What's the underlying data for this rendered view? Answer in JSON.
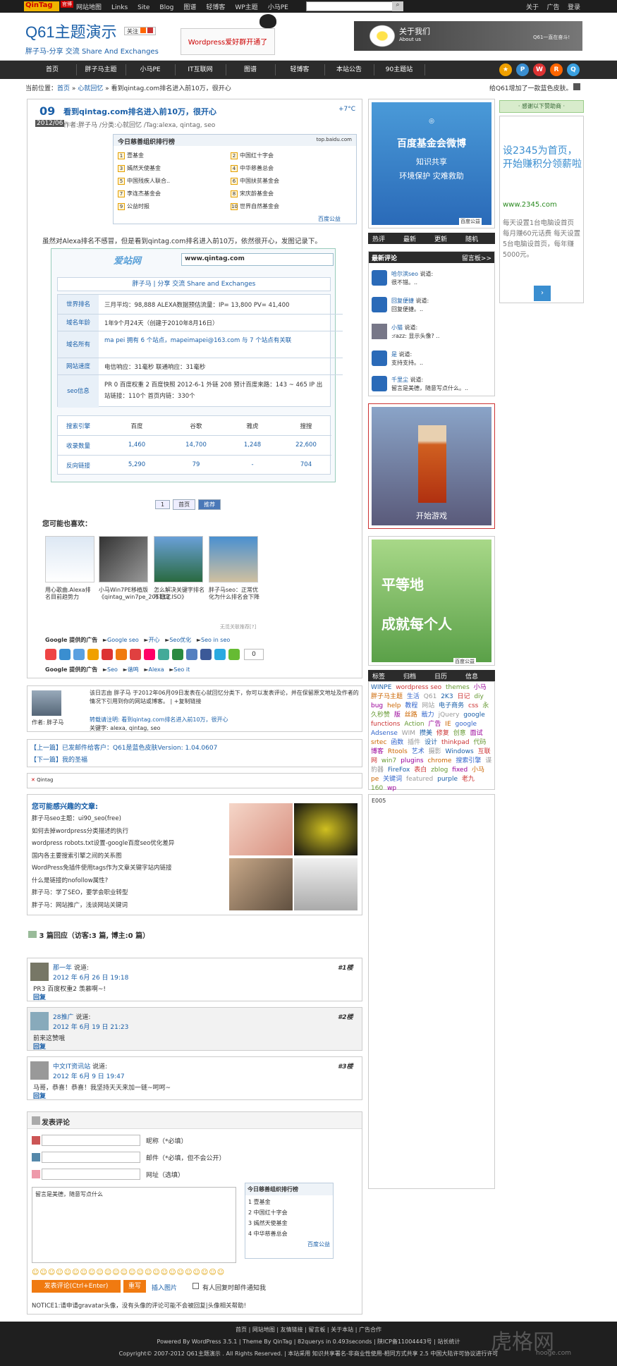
{
  "topbar": {
    "logo": "QinTag",
    "badge": "官博",
    "nav": [
      "网站地图",
      "Links",
      "Site",
      "Blog",
      "图谱",
      "轻博客",
      "WP主题",
      "小马PE"
    ],
    "right": [
      "关于",
      "广告",
      "登录"
    ]
  },
  "header": {
    "title": "Q61主题演示",
    "follow": "关注",
    "subtitle": "胖子马-分享 交流 Share And Exchanges",
    "bubble": "Wordpress爱好群开通了",
    "about": "关于我们",
    "about_en": "About us",
    "slogan": "Q61一直在奋斗!"
  },
  "nav": [
    "首页",
    "胖子马主题",
    "小马PE",
    "IT互联网",
    "图谱",
    "轻博客",
    "本站公告",
    "90主题站"
  ],
  "breadcrumb": {
    "prefix": "当前位置：",
    "home": "首页",
    "cat": "心就回忆",
    "current": "看到qintag.com排名进入前10万，很开心",
    "right": "给Q61增加了一款蓝色皮肤。"
  },
  "post": {
    "day": "09",
    "ym": "2012/06",
    "title": "看到qintag.com排名进入前10万，很开心",
    "author": "作者:胖子马",
    "cat": "/分类:心就回忆",
    "tags": "/Tag:alexa, qintag, seo",
    "temp": "+7°C",
    "body": "虽然对Alexa排名不感冒，但是看到qintag.com排名进入前10万，依然很开心，发图记录下。"
  },
  "rank": {
    "title": "今日慈善组织排行榜",
    "src": "top.baidu.com",
    "items": [
      "壹基金",
      "中国红十字会",
      "嫣然天使基金",
      "中华慈善总会",
      "中国残疾人联合..",
      "中国扶贫基金会",
      "李连杰基金会",
      "宋庆龄基金会",
      "公益时报",
      "世界自然基金会"
    ],
    "foot": "百度公益"
  },
  "alexa": {
    "logo": "爱站网",
    "url": "www.qintag.com",
    "site": "胖子马 | 分享 交流 Share and Exchanges",
    "rows": [
      {
        "label": "世界排名",
        "value": "三月平均：98,888  ALEXA数据预估流量：IP= 13,800 PV= 41,400"
      },
      {
        "label": "域名年龄",
        "value": "1年9个月24天（创建于2010年8月16日）"
      },
      {
        "label": "域名所有",
        "value": "ma pei 拥有 6 个站点，mapeimapei@163.com 与 7 个站点有关联"
      },
      {
        "label": "网站速度",
        "value": "电信响应：31毫秒    联通响应：31毫秒"
      },
      {
        "label": "seo信息",
        "value": "PR 0  百度权重 2   百度快照 2012-6-1   外链 208   预计百度来路：143 ~ 465 IP   出站链接：110个 首页内链：330个"
      }
    ],
    "engines": [
      "搜索引擎",
      "百度",
      "谷歌",
      "雅虎",
      "搜搜"
    ],
    "indexed": [
      "收录数量",
      "1,460",
      "14,700",
      "1,248",
      "22,600"
    ],
    "backlinks": [
      "反向链接",
      "5,290",
      "79",
      "-",
      "704"
    ]
  },
  "pager": [
    "1",
    "首页",
    "推荐"
  ],
  "maylike": {
    "title": "您可能也喜欢：",
    "items": [
      "用心歌曲.Alexa排名目前趋势力",
      "小马Win7PE移植版《qintag_win7pe_201112.ISO》",
      "怎么解决关键字排名不稳定",
      "胖子马seo：正常优化为什么排名会下降"
    ],
    "powered": "无觅关联推荐[?]"
  },
  "ads1": {
    "label": "Google 提供的广告",
    "links": [
      "Google seo",
      "开心",
      "Seo优化",
      "Seo in seo"
    ]
  },
  "ads2": {
    "label": "Google 提供的广告",
    "links": [
      "Seo",
      "谐鸣",
      "Alexa",
      "Seo it"
    ]
  },
  "share_count": "0",
  "author_box": {
    "name": "作者: 胖子马",
    "text": "该日志由 胖子马 于2012年06月09日发表在心就回忆分类下，你可以发表评论，并在保留原文地址及作者的情况下引用到你的网站或博客。 | +复制链接",
    "link": "转载请注明: 看到qintag.com排名进入前10万，很开心",
    "tags": "关键字: alexa, qintag, seo"
  },
  "prevnext": {
    "prev": "【上一篇】已发邮件给客户：Q61是蓝色皮肤Version: 1.04.0607",
    "next": "【下一篇】我的圣福"
  },
  "qintag_small": "Qintag",
  "related": {
    "title": "您可能感兴趣的文章:",
    "items": [
      "胖子马seo主题：ui90_seo(free)",
      "如何去掉wordpress分类描述的执行",
      "wordpress robots.txt设置-google百度seo优化差异",
      "国内各主要搜索引擎之间的关系图",
      "WordPress免插件使用tags作为文章关键字站内链接",
      "什么是链接的nofollow属性?",
      "胖子马：学了SEO，要学会职业转型",
      "胖子马：网站推广，浅谈网站关键词"
    ]
  },
  "comments": {
    "title": "3 篇回应（访客:3 篇, 博主:0 篇）",
    "list": [
      {
        "name": "那一年",
        "said": "说道:",
        "time": "2012 年 6月 26 日 19:18",
        "text": "PR3 百度权重2 羡慕啊~!",
        "reply": "回复",
        "floor": "#1楼"
      },
      {
        "name": "28推广",
        "said": "说道:",
        "time": "2012 年 6月 19 日 21:23",
        "text": "前来这赞哦",
        "reply": "回复",
        "floor": "#2楼"
      },
      {
        "name": "中文IT资讯站",
        "said": "说道:",
        "time": "2012 年 6月 9 日 19:47",
        "text": "马哥，恭喜！恭喜！我坚持天天来加一链~呵呵~",
        "reply": "回复",
        "floor": "#3楼"
      }
    ]
  },
  "form": {
    "title": "发表评论",
    "name_label": "昵称（*必填）",
    "email_label": "邮件（*必填，但不会公开）",
    "url_label": "网址（选填）",
    "placeholder": "留言是美德，随意写点什么",
    "submit": "发表评论(Ctrl+Enter)",
    "reset": "重写",
    "insert": "插入图片",
    "notify": "有人回复时邮件通知我",
    "notice": "NOTICE1:请申请gravatar头像，没有头像的评论可能不会被回复|头像相关帮助!"
  },
  "sidebar": {
    "fund": {
      "title": "百度基金会微博",
      "line1": "知识共享",
      "line2": "环境保护 灾难救助",
      "foot": "百度公益"
    },
    "tabs": [
      "热评",
      "最新",
      "更新",
      "随机"
    ],
    "recent": {
      "title": "最新评论",
      "more": "留言板>>",
      "items": [
        {
          "name": "哈尔滨seo",
          "said": "说道:",
          "text": "很不错。.."
        },
        {
          "name": "回复便捷",
          "said": "说道:",
          "text": "回复便捷。.."
        },
        {
          "name": "小猫",
          "said": "说道:",
          "text": ":razz: 显示头像? .."
        },
        {
          "name": "是",
          "said": "说道:",
          "text": "支持支持。.."
        },
        {
          "name": "千里尘",
          "said": "说道:",
          "text": "留言是美德，随意写点什么。.."
        }
      ]
    },
    "game": "开始游戏",
    "equal": "平等地",
    "everyone": "成就每个人",
    "tabs2": [
      "标签",
      "归档",
      "日历",
      "信息"
    ],
    "tags": [
      "WINPE",
      "wordpress seo",
      "themes",
      "小马",
      "胖子马主题",
      "生活",
      "Q61",
      "2K3",
      "日记",
      "diy",
      "bug",
      "help",
      "教程",
      "网站",
      "电子商务",
      "css",
      "永久秒赞",
      "版",
      "丝路",
      "戢力",
      "jQuery",
      "google",
      "functions",
      "Action",
      "广告",
      "IE",
      "google Adsense",
      "WIM",
      "攒美",
      "修复",
      "创意",
      "面试",
      "srtec",
      "函数",
      "插件",
      "设计",
      "thinkpad",
      "代码",
      "博客",
      "Rtools",
      "艺术",
      "摄影",
      "Windows",
      "互联网",
      "win7",
      "plugins",
      "chrome",
      "搜索引擎",
      "谍豹器",
      "FireFox",
      "表白",
      "zblog",
      "fixed",
      "小马pe",
      "关键词",
      "featured",
      "purple",
      "老九",
      "160",
      "wp"
    ],
    "e005": "E005"
  },
  "ad_right": {
    "title": "· 感谢以下赞助商 ·",
    "text": "设2345为首页，开始赚积分领薪啦",
    "url": "www.2345.com",
    "desc": "每天设置1台电脑设首页 每月赚60元话费 每天设置5台电脑设首页，每年赚5000元。"
  },
  "footer": {
    "links": [
      "首页",
      "网站地图",
      "友情链接",
      "留言板",
      "关于本站",
      "广告合作"
    ],
    "powered": "Powered By  WordPress 3.5.1  |  Theme By  QinTag  |  82querys in 0.493seconds  |  陕ICP备11004443号  |  站长统计",
    "copy": "Copyright© 2007-2012  Q61主题演示  . All Rights Reserved.  |  本站采用 知识共享署名-非商业性使用-相同方式共享 2.5 中国大陆许可协议进行许可",
    "watermark": "虎格网",
    "wm_url": "hooge.com"
  },
  "colors": {
    "accent": "#1a5fa8",
    "nav": "#2b2b2b",
    "orange": "#f07a10"
  }
}
